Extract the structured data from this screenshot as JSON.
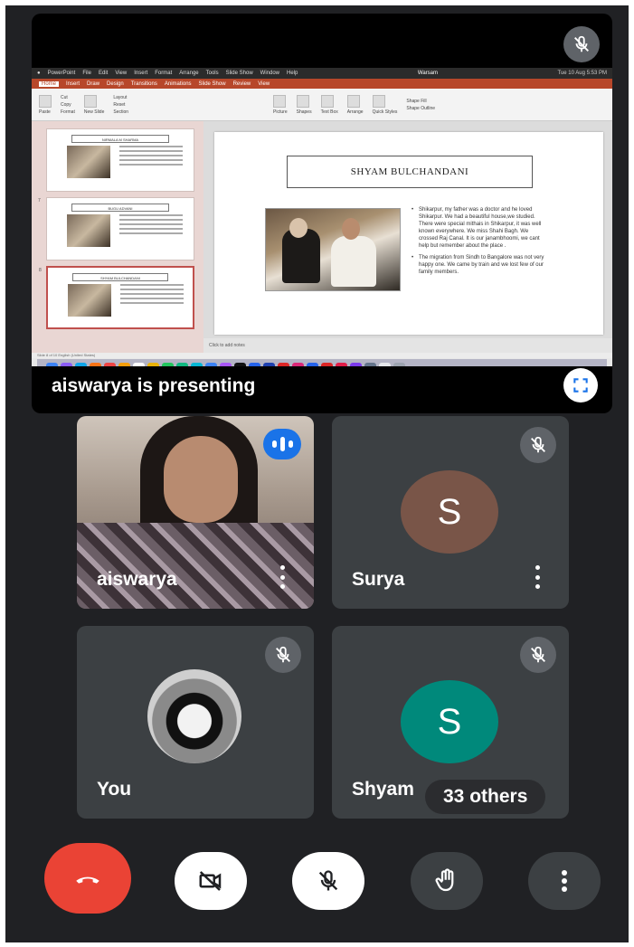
{
  "presentation": {
    "presenter_label": "aiswarya is presenting",
    "mac_menu": [
      "PowerPoint",
      "File",
      "Edit",
      "View",
      "Insert",
      "Format",
      "Arrange",
      "Tools",
      "Slide Show",
      "Window",
      "Help"
    ],
    "mac_title": "Warsam",
    "mac_clock": "Tue 10 Aug 5:53 PM",
    "ppt_tabs": [
      "Home",
      "Insert",
      "Draw",
      "Design",
      "Transitions",
      "Animations",
      "Slide Show",
      "Review",
      "View"
    ],
    "ribbon_items": [
      "Paste",
      "Cut",
      "Copy",
      "Format",
      "New Slide",
      "Layout",
      "Reset",
      "Section",
      "Picture",
      "Shapes",
      "Text Box",
      "Arrange",
      "Quick Styles",
      "Shape Fill",
      "Shape Outline"
    ],
    "thumbnails": [
      {
        "num": "",
        "title": "NIRMALA M SHARMA"
      },
      {
        "num": "7",
        "title": "BUGU ADVANI"
      },
      {
        "num": "8",
        "title": "SHYAM BULCHANDANI"
      }
    ],
    "slide": {
      "title": "SHYAM BULCHANDANI",
      "bullets": [
        "Shikarpur, my father was a doctor and he loved Shikarpur. We had a beautiful house,we studied. There were special mithais in Shikarpur, it was well known everywhere. We miss Shahi Bagh. We crossed Raj Canal. It is our janambhoomi, we cant help but remember about the place .",
        "The migration from Sindh to Bangalore was not very happy one. We came by train and we lost few of our family members."
      ]
    },
    "notes_placeholder": "Click to add notes",
    "status_text": "Slide 8 of 10   English (United States)"
  },
  "participants": [
    {
      "name": "aiswarya",
      "initial": "",
      "speaking": true
    },
    {
      "name": "Surya",
      "initial": "S",
      "avatar_color": "#795548",
      "muted": true
    },
    {
      "name": "You",
      "initial": "",
      "muted": true
    },
    {
      "name": "Shyam",
      "initial": "S",
      "avatar_color": "#00897b",
      "muted": true
    }
  ],
  "others_label": "33 others",
  "controls": {
    "end_call": "end-call",
    "camera": "camera-off",
    "mic": "mic-off",
    "raise_hand": "raise-hand",
    "more": "more-options"
  },
  "colors": {
    "end_call_red": "#ea4335",
    "speaking_blue": "#1a73e8",
    "background": "#202124",
    "tile": "#3c4043"
  }
}
